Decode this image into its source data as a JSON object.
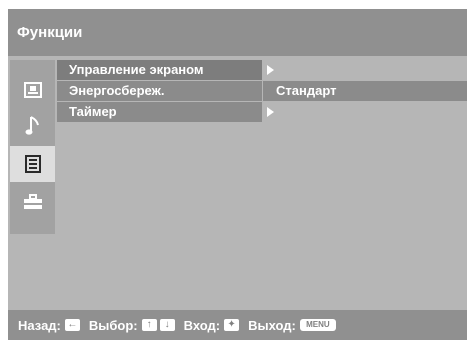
{
  "header": {
    "title": "Функции"
  },
  "sidebar": {
    "icons": [
      {
        "name": "picture-icon",
        "glyph": "🖻"
      },
      {
        "name": "music-note-icon",
        "glyph": "♪"
      },
      {
        "name": "features-list-icon",
        "glyph": "☰"
      },
      {
        "name": "toolbox-icon",
        "glyph": "⛑"
      }
    ],
    "selected_index": 2
  },
  "menu": {
    "items": [
      {
        "label": "Управление экраном",
        "value": ""
      },
      {
        "label": "Энергосбереж.",
        "value": "Стандарт"
      },
      {
        "label": "Таймер",
        "value": ""
      }
    ]
  },
  "footer": {
    "back_label": "Назад:",
    "select_label": "Выбор:",
    "enter_label": "Вход:",
    "exit_label": "Выход:",
    "menu_key": "MENU",
    "left_key": "←",
    "up_key": "↑",
    "down_key": "↓",
    "enter_key": "✦"
  }
}
